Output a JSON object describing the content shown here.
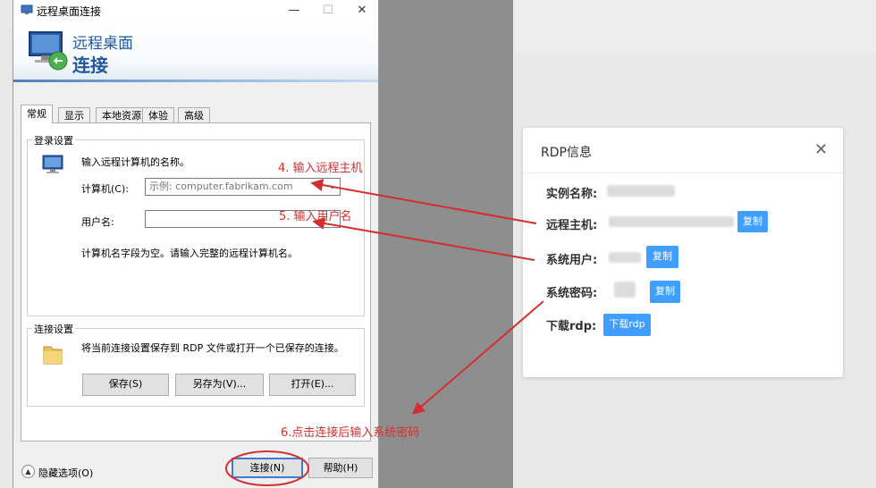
{
  "window": {
    "title": "远程桌面连接",
    "minimize": "—",
    "maximize": "☐",
    "close": "✕",
    "banner_line1": "远程桌面",
    "banner_line2": "连接"
  },
  "tabs": [
    "常规",
    "显示",
    "本地资源",
    "体验",
    "高级"
  ],
  "login": {
    "group_label": "登录设置",
    "hint": "输入远程计算机的名称。",
    "computer_label": "计算机(C):",
    "computer_placeholder": "示例: computer.fabrikam.com",
    "username_label": "用户名:",
    "username_value": "",
    "empty_note": "计算机名字段为空。请输入完整的远程计算机名。"
  },
  "connection": {
    "group_label": "连接设置",
    "hint": "将当前连接设置保存到 RDP 文件或打开一个已保存的连接。",
    "save": "保存(S)",
    "save_as": "另存为(V)...",
    "open": "打开(E)..."
  },
  "footer": {
    "hide_options": "隐藏选项(O)",
    "connect": "连接(N)",
    "help": "帮助(H)"
  },
  "rdp_card": {
    "title": "RDP信息",
    "close": "✕",
    "instance_name_label": "实例名称:",
    "host_label": "远程主机:",
    "user_label": "系统用户:",
    "password_label": "系统密码:",
    "download_label": "下载rdp:",
    "copy": "复制",
    "download_button": "下载rdp"
  },
  "annotations": {
    "step4": "4. 输入远程主机",
    "step5": "5. 输入用户名",
    "step6": "6.点击连接后输入系统密码",
    "color": "#d32f2f"
  },
  "colors": {
    "accent_blue": "#409eff",
    "banner_blue": "#1e5a9e"
  }
}
